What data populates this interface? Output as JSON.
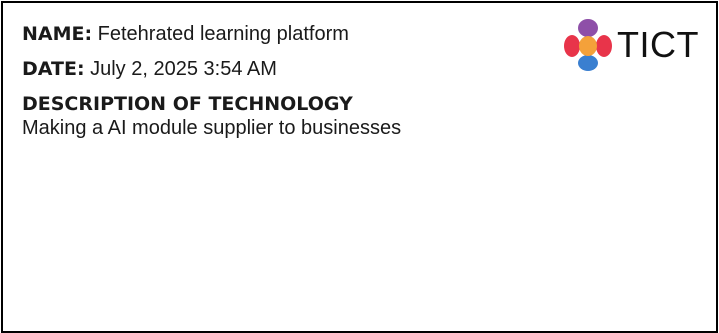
{
  "fields": {
    "name_label": "NAME:",
    "name_value": "Fetehrated learning platform",
    "date_label": "DATE:",
    "date_value": "July 2, 2025 3:54 AM"
  },
  "description": {
    "heading": "DESCRIPTION OF TECHNOLOGY",
    "text": "Making a AI module supplier to businesses"
  },
  "logo": {
    "text": "TICT",
    "colors": {
      "top": "#8e4fa8",
      "left": "#e8344a",
      "right": "#e8344a",
      "bottom": "#3a7fd0",
      "center": "#f4a13a"
    }
  },
  "colors": {
    "text": "#1a1a1a",
    "border": "#000000",
    "background": "#ffffff"
  }
}
